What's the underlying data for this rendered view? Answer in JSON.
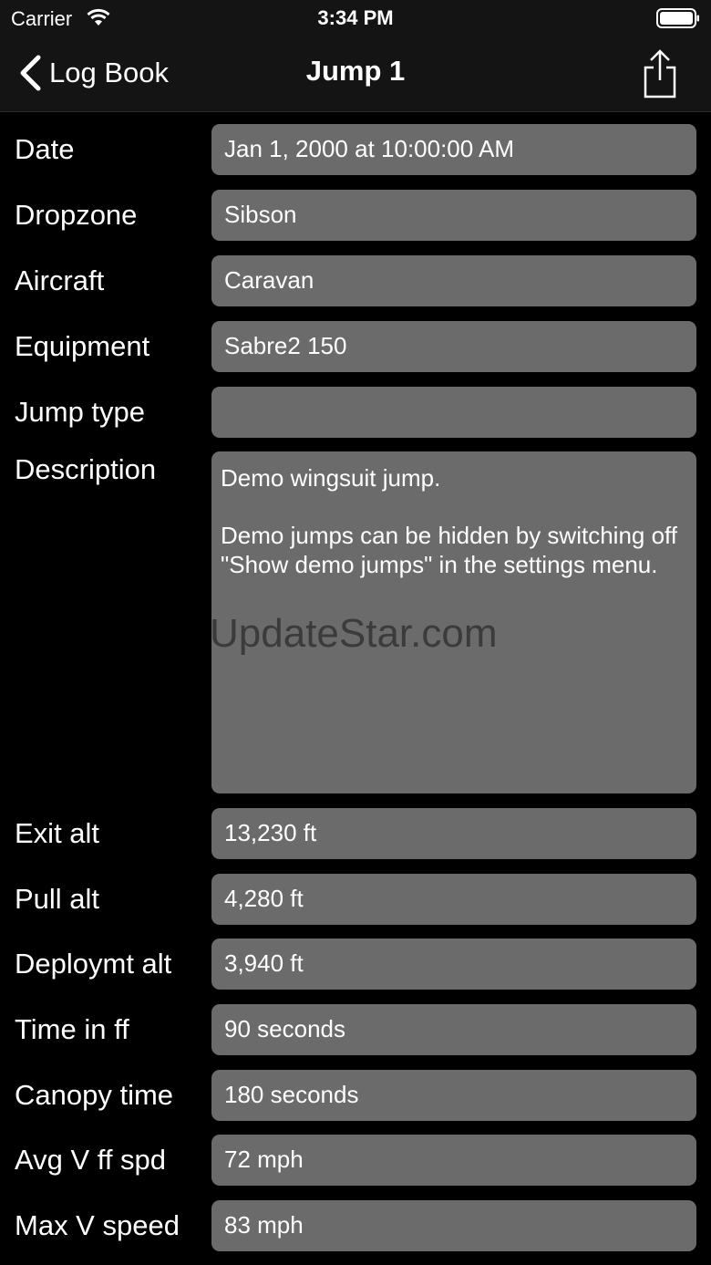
{
  "status_bar": {
    "carrier": "Carrier",
    "time": "3:34 PM"
  },
  "nav": {
    "back_label": "Log Book",
    "title": "Jump 1"
  },
  "fields": [
    {
      "label": "Date",
      "value": "Jan 1, 2000 at 10:00:00 AM"
    },
    {
      "label": "Dropzone",
      "value": "Sibson"
    },
    {
      "label": "Aircraft",
      "value": "Caravan"
    },
    {
      "label": "Equipment",
      "value": "Sabre2 150"
    },
    {
      "label": "Jump type",
      "value": ""
    },
    {
      "label": "Description",
      "value": "Demo wingsuit jump.\n\nDemo jumps can be hidden by switching off \"Show demo jumps\" in the settings menu."
    },
    {
      "label": "Exit alt",
      "value": "13,230 ft"
    },
    {
      "label": "Pull alt",
      "value": "4,280 ft"
    },
    {
      "label": "Deploymt alt",
      "value": "3,940 ft"
    },
    {
      "label": "Time in ff",
      "value": "90 seconds"
    },
    {
      "label": "Canopy time",
      "value": "180 seconds"
    },
    {
      "label": "Avg V ff spd",
      "value": "72 mph"
    },
    {
      "label": "Max V speed",
      "value": "83 mph"
    }
  ],
  "watermark": "UpdateStar.com",
  "icons": {
    "wifi": "wifi-icon",
    "battery": "battery-icon",
    "back": "chevron-left-icon",
    "share": "share-icon"
  },
  "colors": {
    "background": "#000000",
    "field_background": "#6b6b6b",
    "bar_background": "#141414"
  }
}
